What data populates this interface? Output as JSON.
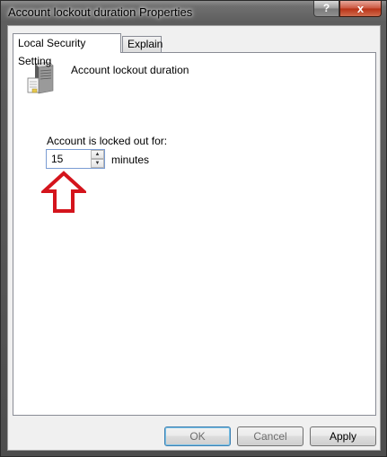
{
  "window": {
    "title": "Account lockout duration Properties",
    "help_glyph": "?",
    "close_glyph": "x"
  },
  "tabs": [
    {
      "label": "Local Security Setting",
      "active": true
    },
    {
      "label": "Explain",
      "active": false
    }
  ],
  "policy": {
    "name": "Account lockout duration",
    "icon": "server-icon"
  },
  "lockout": {
    "label": "Account is locked out for:",
    "value": "15",
    "unit": "minutes"
  },
  "buttons": {
    "ok": "OK",
    "cancel": "Cancel",
    "apply": "Apply"
  },
  "colors": {
    "arrow": "#d4141c",
    "focus_border": "#3c7fb1"
  }
}
